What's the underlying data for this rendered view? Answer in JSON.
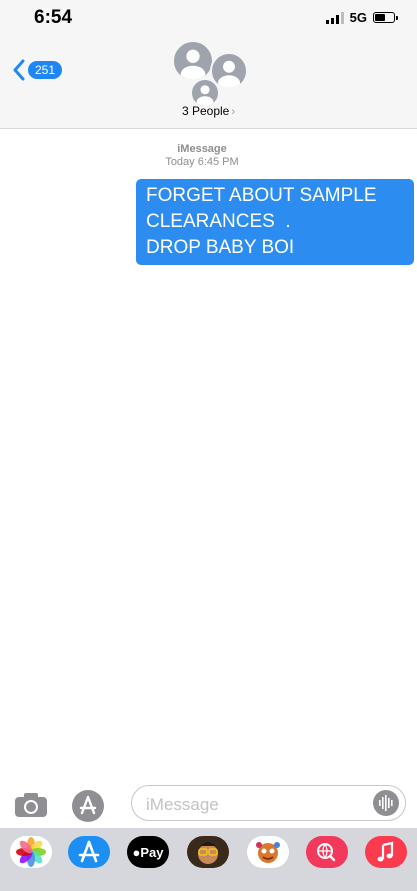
{
  "status_bar": {
    "time": "6:54",
    "network": "5G",
    "signal_bars": 3,
    "battery_level": 0.45
  },
  "header": {
    "back_count": "251",
    "group_name": "3 People",
    "group_chevron": "›",
    "icons": [
      "back-chevron-icon",
      "group-avatar-icon"
    ]
  },
  "thread": {
    "service": "iMessage",
    "timestamp": "Today 6:45 PM",
    "messages": [
      {
        "direction": "outgoing",
        "text": "FORGET ABOUT SAMPLE\nCLEARANCES  .\nDROP BABY BOI"
      }
    ]
  },
  "composer": {
    "placeholder": "iMessage",
    "value": "",
    "icons": [
      "camera-icon",
      "app-store-icon",
      "audio-waveform-icon"
    ]
  },
  "app_drawer": {
    "apps": [
      {
        "name": "photos",
        "icon": "photos-icon"
      },
      {
        "name": "app-store",
        "icon": "app-store-icon"
      },
      {
        "name": "apple-pay",
        "icon": "apple-pay-icon",
        "label": "Pay"
      },
      {
        "name": "memoji",
        "icon": "memoji-icon"
      },
      {
        "name": "animoji",
        "icon": "animoji-icon"
      },
      {
        "name": "images-search",
        "icon": "globe-search-icon"
      },
      {
        "name": "music",
        "icon": "music-note-icon"
      }
    ]
  },
  "colors": {
    "bubble": "#2d8cf0",
    "badge": "#1f87f5",
    "header_bg": "#f6f6f6",
    "drawer_bg": "#d6d7dc"
  }
}
